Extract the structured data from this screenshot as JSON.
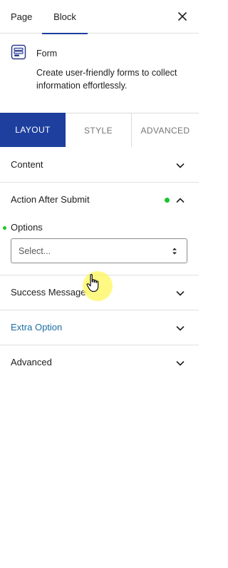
{
  "top_tabs": {
    "page": "Page",
    "block": "Block"
  },
  "icons": {
    "close": "close-icon",
    "block": "form-block-icon",
    "chevron_down": "chevron-down-icon",
    "chevron_up": "chevron-up-icon",
    "select_arrows": "select-arrows-icon",
    "cursor": "hand-pointer-cursor-icon"
  },
  "block": {
    "name": "Form",
    "description": "Create user-friendly forms to collect information effortlessly."
  },
  "sub_tabs": {
    "layout": "LAYOUT",
    "style": "STYLE",
    "advanced": "ADVANCED",
    "active": "LAYOUT"
  },
  "panels": {
    "content": "Content",
    "action_after_submit": "Action After Submit",
    "success_message": "Success Message",
    "extra_option": "Extra Option",
    "advanced": "Advanced"
  },
  "options": {
    "label": "Options",
    "select_value": "Select..."
  },
  "colors": {
    "accent": "#1e3f9e",
    "status_green": "#18c52c",
    "link_blue": "#1b6ea5",
    "cursor_highlight": "#fff75a"
  }
}
